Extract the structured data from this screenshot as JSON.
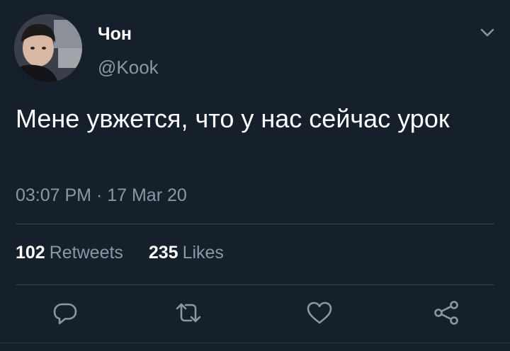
{
  "tweet": {
    "author": {
      "display_name": "Чон",
      "handle": "@Kook"
    },
    "text": "Мене увжется, что у нас сейчас урок",
    "timestamp": "03:07 PM · 17 Mar 20",
    "stats": {
      "retweets_count": "102",
      "retweets_label": "Retweets",
      "likes_count": "235",
      "likes_label": "Likes"
    }
  },
  "icons": {
    "menu": "chevron-down-icon",
    "reply": "reply-icon",
    "retweet": "retweet-icon",
    "like": "heart-icon",
    "share": "share-icon"
  },
  "colors": {
    "background": "#15202b",
    "primary_text": "#ffffff",
    "secondary_text": "#8899a6",
    "divider": "#38444d"
  }
}
